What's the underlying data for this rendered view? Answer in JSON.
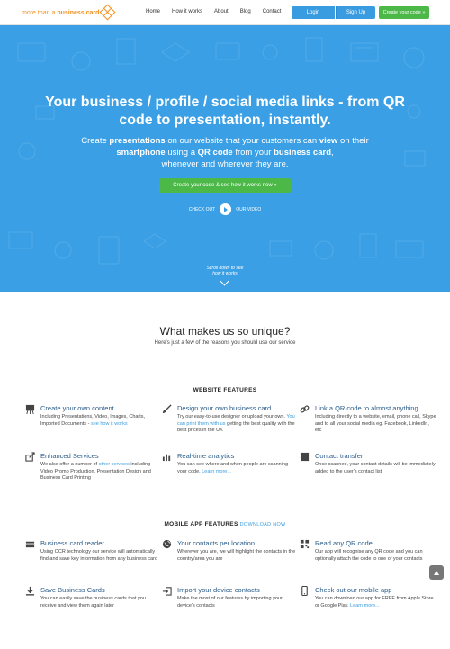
{
  "header": {
    "logo": {
      "text_pre": "more than a ",
      "text_bold": "business card"
    },
    "nav": [
      "Home",
      "How it works",
      "About",
      "Blog",
      "Contact"
    ],
    "login": "Login",
    "signup": "Sign Up",
    "create": "Create your code »"
  },
  "hero": {
    "title": "Your business / profile / social media links - from QR code to presentation, instantly.",
    "sub": {
      "p1": "Create ",
      "b1": "presentations",
      "p2": " on our website that your customers can ",
      "b2": "view",
      "p3": " on their ",
      "b3": "smartphone",
      "p4": " using a ",
      "b4": "QR code",
      "p5": " from your ",
      "b5": "business card",
      "p6": ",",
      "p7": "whenever and wherever they are."
    },
    "cta": "Create your code & see how it works now »",
    "check_out": "CHECK OUT",
    "our_video": "OUR VIDEO",
    "scroll_1": "Scroll down to see",
    "scroll_2": "how it works"
  },
  "unique": {
    "title": "What makes us so unique?",
    "subtitle": "Here's just a few of the reasons you should use our service"
  },
  "website_features": {
    "heading": "WEBSITE FEATURES",
    "items": [
      {
        "icon": "easel-icon",
        "title": "Create your own content",
        "desc": "Including Presentations, Video, Images, Charts, Imported Documents - ",
        "link": "see how it works",
        "desc2": ""
      },
      {
        "icon": "brush-icon",
        "title": "Design your own business card",
        "desc": "Try our easy-to-use designer or upload your own. ",
        "link": "You can print them with us",
        "desc2": " getting the best quality with the best prices in the UK"
      },
      {
        "icon": "link-icon",
        "title": "Link a QR code to almost anything",
        "desc": "Including directly to a website, email, phone call, Skype and to all your social media eg. Facebook, LinkedIn, etc",
        "link": "",
        "desc2": ""
      },
      {
        "icon": "share-icon",
        "title": "Enhanced Services",
        "desc": "We also offer a number of ",
        "link": "other services",
        "desc2": " including Video Promo Production, Presentation Design and Business Card Printing"
      },
      {
        "icon": "bar-chart-icon",
        "title": "Real-time analytics",
        "desc": "You can see where and when people are scanning your code. ",
        "link": "Learn more...",
        "desc2": ""
      },
      {
        "icon": "contact-card-icon",
        "title": "Contact transfer",
        "desc": "Once scanned, your contact details will be immediately added to the user's contact list",
        "link": "",
        "desc2": ""
      }
    ]
  },
  "mobile_features": {
    "heading": "MOBILE APP FEATURES",
    "download": "DOWNLOAD NOW",
    "items": [
      {
        "icon": "card-reader-icon",
        "title": "Business card reader",
        "desc": "Using OCR technology our service will automatically find and save key information from any business card",
        "link": "",
        "desc2": ""
      },
      {
        "icon": "globe-icon",
        "title": "Your contacts per location",
        "desc": "Wherever you are, we will highlight the contacts in the country/area you are",
        "link": "",
        "desc2": ""
      },
      {
        "icon": "qr-code-icon",
        "title": "Read any QR code",
        "desc": "Our app will recognise any QR code and you can optionally attach the code to one of your contacts",
        "link": "",
        "desc2": ""
      },
      {
        "icon": "download-icon",
        "title": "Save Business Cards",
        "desc": "You can easily save the business cards that you receive and view them again later",
        "link": "",
        "desc2": ""
      },
      {
        "icon": "import-icon",
        "title": "Import your device contacts",
        "desc": "Make the most of our features by importing your device's contacts",
        "link": "",
        "desc2": ""
      },
      {
        "icon": "phone-icon",
        "title": "Check out our mobile app",
        "desc": "You can download our app for FREE from Apple Store or Google Play. ",
        "link": "Learn more...",
        "desc2": ""
      }
    ]
  },
  "colors": {
    "accent": "#3a9ce0",
    "hero_bg": "#3a9fe4",
    "green": "#4cb848",
    "logo": "#f29021",
    "feature_title": "#2a5c8a"
  }
}
